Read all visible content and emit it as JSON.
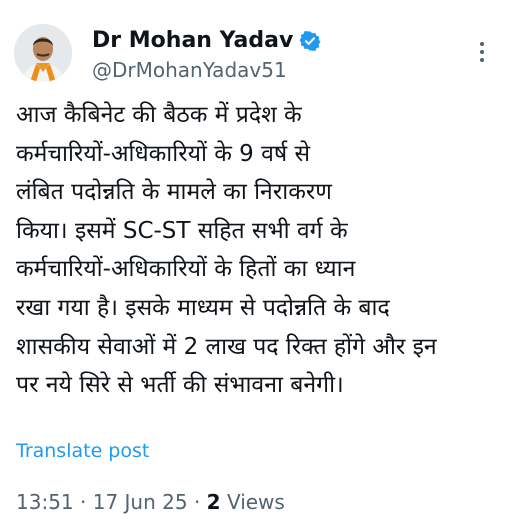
{
  "author": {
    "display_name": "Dr Mohan Yadav",
    "handle": "@DrMohanYadav51",
    "verified": true
  },
  "colors": {
    "text_primary": "#0f1419",
    "text_secondary": "#536471",
    "accent": "#1d9bf0"
  },
  "icons": {
    "verified": "verified-badge-icon",
    "more": "more-options-icon"
  },
  "tweet": {
    "text": "आज कैबिनेट की बैठक में प्रदेश के\nकर्मचारियों-अधिकारियों के 9 वर्ष से\nलंबित पदोन्नति के मामले का निराकरण\nकिया। इसमें SC-ST सहित सभी वर्ग के\nकर्मचारियों-अधिकारियों के हितों का ध्यान\nरखा गया है। इसके माध्यम से पदोन्नति के बाद\nशासकीय सेवाओं में 2 लाख पद रिक्त होंगे और इन\nपर नये सिरे से भर्ती की संभावना बनेगी।",
    "translate_label": "Translate post",
    "time": "13:51",
    "separator": " · ",
    "date": "17 Jun 25",
    "views_count": "2",
    "views_label": " Views"
  }
}
